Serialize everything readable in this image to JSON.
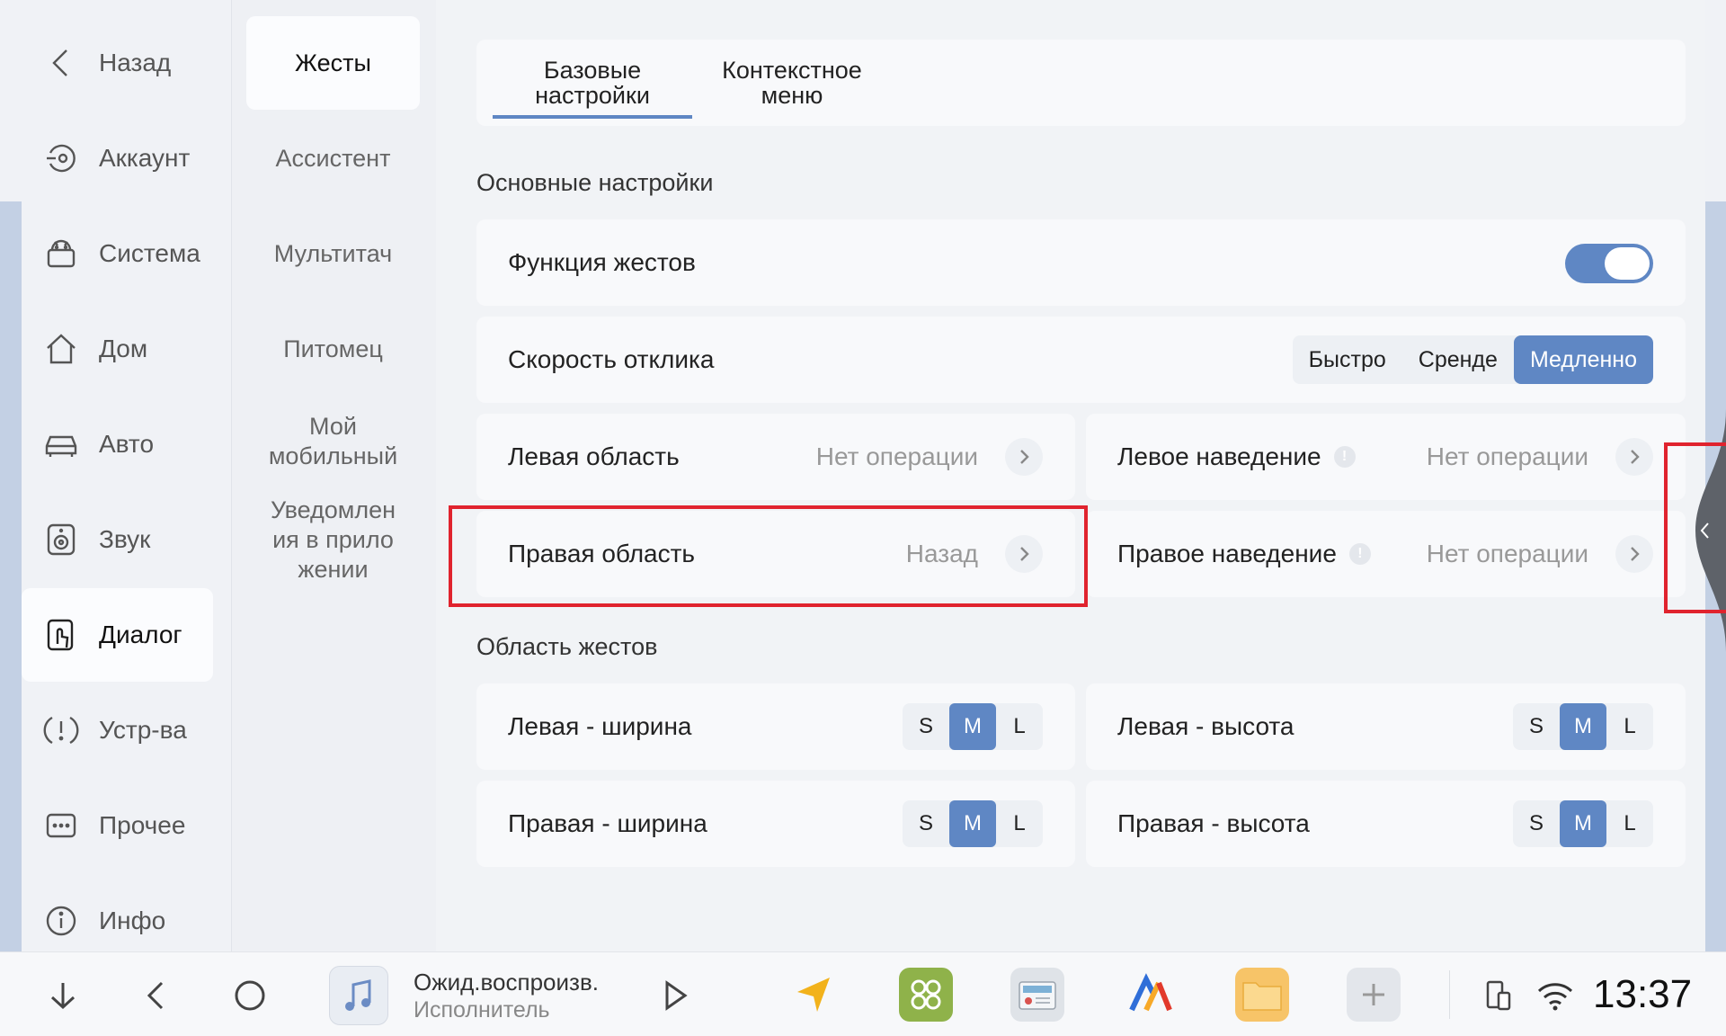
{
  "nav": {
    "items": [
      {
        "label": "Назад",
        "icon": "back-chevron-icon"
      },
      {
        "label": "Аккаунт",
        "icon": "account-icon"
      },
      {
        "label": "Система",
        "icon": "android-icon"
      },
      {
        "label": "Дом",
        "icon": "home-icon"
      },
      {
        "label": "Авто",
        "icon": "car-icon"
      },
      {
        "label": "Звук",
        "icon": "speaker-icon"
      },
      {
        "label": "Диалог",
        "icon": "touch-icon"
      },
      {
        "label": "Устр-ва",
        "icon": "alert-icon"
      },
      {
        "label": "Прочее",
        "icon": "more-icon"
      },
      {
        "label": "Инфо",
        "icon": "info-icon"
      }
    ],
    "active": "Диалог"
  },
  "subnav": {
    "items": [
      "Жесты",
      "Ассистент",
      "Мультитач",
      "Питомец",
      "Мой мобильный",
      "Уведомлен ия в прило жении"
    ],
    "active": "Жесты"
  },
  "tabs": {
    "basic": "Базовые настройки",
    "context": "Контекстное меню"
  },
  "sections": {
    "main": "Основные настройки",
    "area": "Область жестов"
  },
  "settings": {
    "gesture_function": {
      "label": "Функция жестов",
      "enabled": true
    },
    "response_speed": {
      "label": "Скорость отклика",
      "options": [
        "Быстро",
        "Сренде",
        "Медленно"
      ],
      "selected": "Медленно"
    },
    "left_area": {
      "label": "Левая область",
      "value": "Нет операции"
    },
    "left_hover": {
      "label": "Левое наведение",
      "value": "Нет операции"
    },
    "right_area": {
      "label": "Правая область",
      "value": "Назад"
    },
    "right_hover": {
      "label": "Правое наведение",
      "value": "Нет операции"
    }
  },
  "area": {
    "left_width": {
      "label": "Левая - ширина",
      "selected": "M"
    },
    "left_height": {
      "label": "Левая - высота",
      "selected": "M"
    },
    "right_width": {
      "label": "Правая - ширина",
      "selected": "M"
    },
    "right_height": {
      "label": "Правая - высота",
      "selected": "M"
    },
    "sizes": [
      "S",
      "M",
      "L"
    ]
  },
  "taskbar": {
    "media_title": "Ожид.воспроизв.",
    "media_artist": "Исполнитель",
    "clock": "13:37"
  },
  "colors": {
    "accent": "#5f87c4",
    "highlight": "#e0232e"
  }
}
